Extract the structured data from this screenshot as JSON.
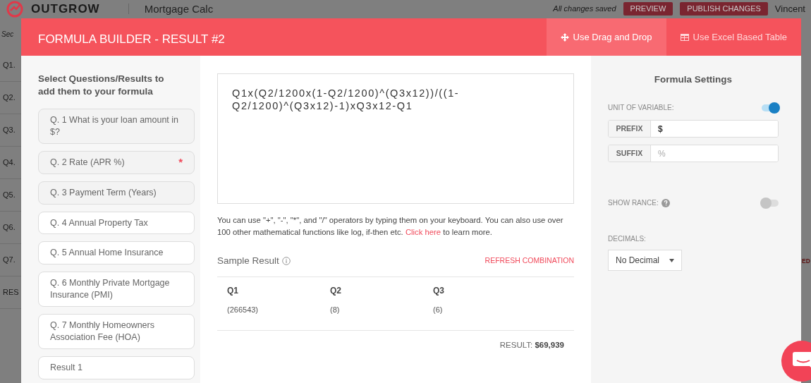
{
  "app": {
    "logo": "OUTGROW",
    "title": "Mortgage Calc",
    "save_status": "All changes saved",
    "buttons": [
      "PREVIEW",
      "PUBLISH CHANGES"
    ],
    "user": "Vincent",
    "sidebar_label": "Sec",
    "rows": [
      "Q1.",
      "Q2.",
      "Q3.",
      "Q4.",
      "Q5.",
      "Q6.",
      "Q7.",
      "RES"
    ],
    "side_tag": "ED"
  },
  "modal": {
    "title": "FORMULA BUILDER - RESULT #2",
    "modes": [
      {
        "label": "Use Drag and Drop",
        "selected": true,
        "kind": "move"
      },
      {
        "label": "Use Excel Based Table",
        "selected": false,
        "kind": "table"
      }
    ]
  },
  "picker": {
    "heading": "Select Questions/Results to add them to your formula",
    "items": [
      {
        "label": "Q. 1 What is your loan amount in $?",
        "used": true
      },
      {
        "label": "Q. 2 Rate (APR %)",
        "used": true,
        "badge": "*"
      },
      {
        "label": "Q. 3 Payment Term (Years)",
        "used": true
      },
      {
        "label": "Q. 4 Annual Property Tax",
        "used": false
      },
      {
        "label": "Q. 5 Annual Home Insurance",
        "used": false
      },
      {
        "label": "Q. 6 Monthly Private Mortgage Insurance (PMI)",
        "used": false
      },
      {
        "label": "Q. 7 Monthly Homeowners Association Fee (HOA)",
        "used": false
      },
      {
        "label": "Result 1",
        "used": false
      }
    ]
  },
  "formula": {
    "value": "Q1x(Q2/1200x(1-Q2/1200)^(Q3x12))/((1-Q2/1200)^(Q3x12)-1)xQ3x12-Q1",
    "help_before": "You can use \"+\", \"-\", \"*\", and \"/\" operators by typing them on your keyboard. You can also use over 100 other mathematical functions like log, if-then etc.",
    "help_link": "Click here",
    "help_after": "to learn more."
  },
  "sample": {
    "title": "Sample Result",
    "action": "REFRESH COMBINATION",
    "columns": [
      {
        "name": "Q1",
        "value": "(266543)"
      },
      {
        "name": "Q2",
        "value": "(8)"
      },
      {
        "name": "Q3",
        "value": "(6)"
      }
    ],
    "result_label": "RESULT:",
    "result_value": "$69,939"
  },
  "settings": {
    "title": "Formula Settings",
    "unit": {
      "label": "UNIT OF VARIABLE:",
      "on": true
    },
    "prefix": {
      "label": "PREFIX",
      "value": "$"
    },
    "suffix": {
      "label": "SUFFIX",
      "placeholder": "%"
    },
    "range": {
      "label": "SHOW RANCE:",
      "on": false
    },
    "decimals": {
      "label": "DECIMALS:",
      "value": "No Decimal"
    }
  }
}
